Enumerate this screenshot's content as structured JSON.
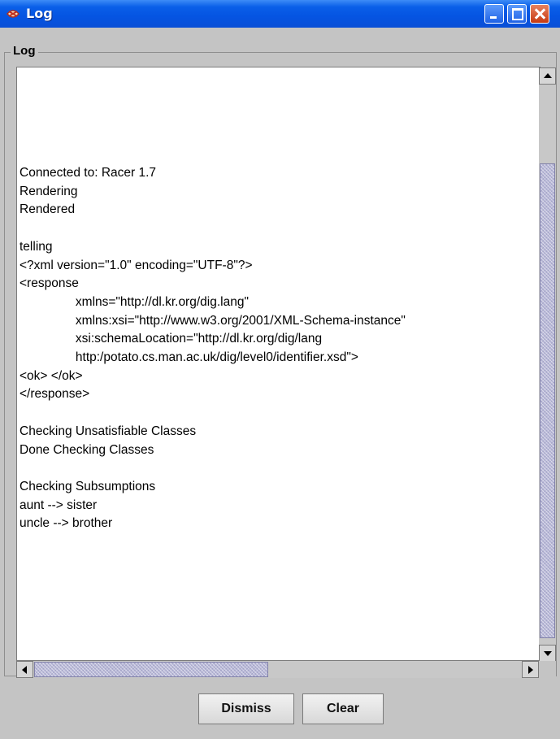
{
  "window": {
    "title": "Log",
    "icons": [
      "app-icon",
      "minimize-icon",
      "maximize-icon",
      "close-icon"
    ]
  },
  "group": {
    "title": "Log"
  },
  "log": {
    "text": "Connected to: Racer 1.7\nRendering\nRendered\n\ntelling\n<?xml version=\"1.0\" encoding=\"UTF-8\"?>\n<response\n                xmlns=\"http://dl.kr.org/dig.lang\"\n                xmlns:xsi=\"http://www.w3.org/2001/XML-Schema-instance\"\n                xsi:schemaLocation=\"http://dl.kr.org/dig/lang\n                http:/potato.cs.man.ac.uk/dig/level0/identifier.xsd\">\n<ok> </ok>\n</response>\n\nChecking Unsatisfiable Classes\nDone Checking Classes\n\nChecking Subsumptions\naunt --> sister\nuncle --> brother"
  },
  "scrollbars": {
    "vertical_position": 0.17,
    "horizontal_position": 0.0
  },
  "buttons": {
    "dismiss": "Dismiss",
    "clear": "Clear"
  },
  "colors": {
    "titlebar": "#0554e2",
    "window_bg": "#c4c4c4",
    "thumb": "#b8b8d8"
  }
}
